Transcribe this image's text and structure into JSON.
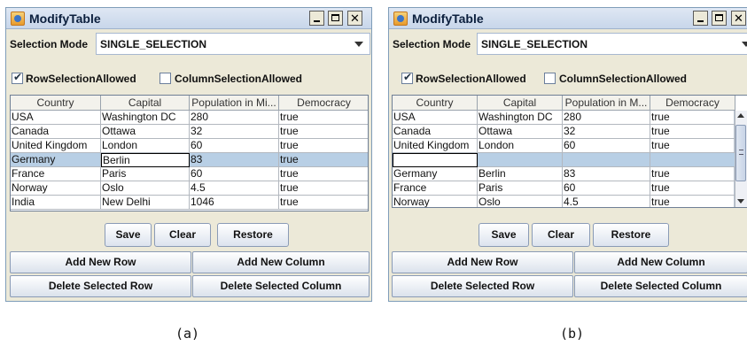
{
  "captions": [
    "(a)",
    "(b)"
  ],
  "window_a": {
    "title": "ModifyTable",
    "selection_mode_label": "Selection Mode",
    "selection_mode_value": "SINGLE_SELECTION",
    "row_selection_label": "RowSelectionAllowed",
    "row_selection_checked": true,
    "column_selection_label": "ColumnSelectionAllowed",
    "column_selection_checked": false,
    "columns": [
      "Country",
      "Capital",
      "Population in Mi...",
      "Democracy"
    ],
    "rows": [
      [
        "USA",
        "Washington DC",
        "280",
        "true"
      ],
      [
        "Canada",
        "Ottawa",
        "32",
        "true"
      ],
      [
        "United Kingdom",
        "London",
        "60",
        "true"
      ],
      [
        "Germany",
        "Berlin",
        "83",
        "true"
      ],
      [
        "France",
        "Paris",
        "60",
        "true"
      ],
      [
        "Norway",
        "Oslo",
        "4.5",
        "true"
      ],
      [
        "India",
        "New Delhi",
        "1046",
        "true"
      ]
    ],
    "selected_row": 3,
    "editing_cell": [
      3,
      1
    ],
    "buttons": {
      "save": "Save",
      "clear": "Clear",
      "restore": "Restore"
    },
    "actions": {
      "add_row": "Add New Row",
      "add_column": "Add New Column",
      "delete_row": "Delete Selected Row",
      "delete_column": "Delete Selected Column"
    }
  },
  "window_b": {
    "title": "ModifyTable",
    "selection_mode_label": "Selection Mode",
    "selection_mode_value": "SINGLE_SELECTION",
    "row_selection_label": "RowSelectionAllowed",
    "row_selection_checked": true,
    "column_selection_label": "ColumnSelectionAllowed",
    "column_selection_checked": false,
    "columns": [
      "Country",
      "Capital",
      "Population in M...",
      "Democracy"
    ],
    "rows": [
      [
        "USA",
        "Washington DC",
        "280",
        "true"
      ],
      [
        "Canada",
        "Ottawa",
        "32",
        "true"
      ],
      [
        "United Kingdom",
        "London",
        "60",
        "true"
      ],
      [
        "",
        "",
        "",
        ""
      ],
      [
        "Germany",
        "Berlin",
        "83",
        "true"
      ],
      [
        "France",
        "Paris",
        "60",
        "true"
      ],
      [
        "Norway",
        "Oslo",
        "4.5",
        "true"
      ]
    ],
    "selected_row": 3,
    "editing_cell": [
      3,
      0
    ],
    "buttons": {
      "save": "Save",
      "clear": "Clear",
      "restore": "Restore"
    },
    "actions": {
      "add_row": "Add New Row",
      "add_column": "Add New Column",
      "delete_row": "Delete Selected Row",
      "delete_column": "Delete Selected Column"
    }
  }
}
